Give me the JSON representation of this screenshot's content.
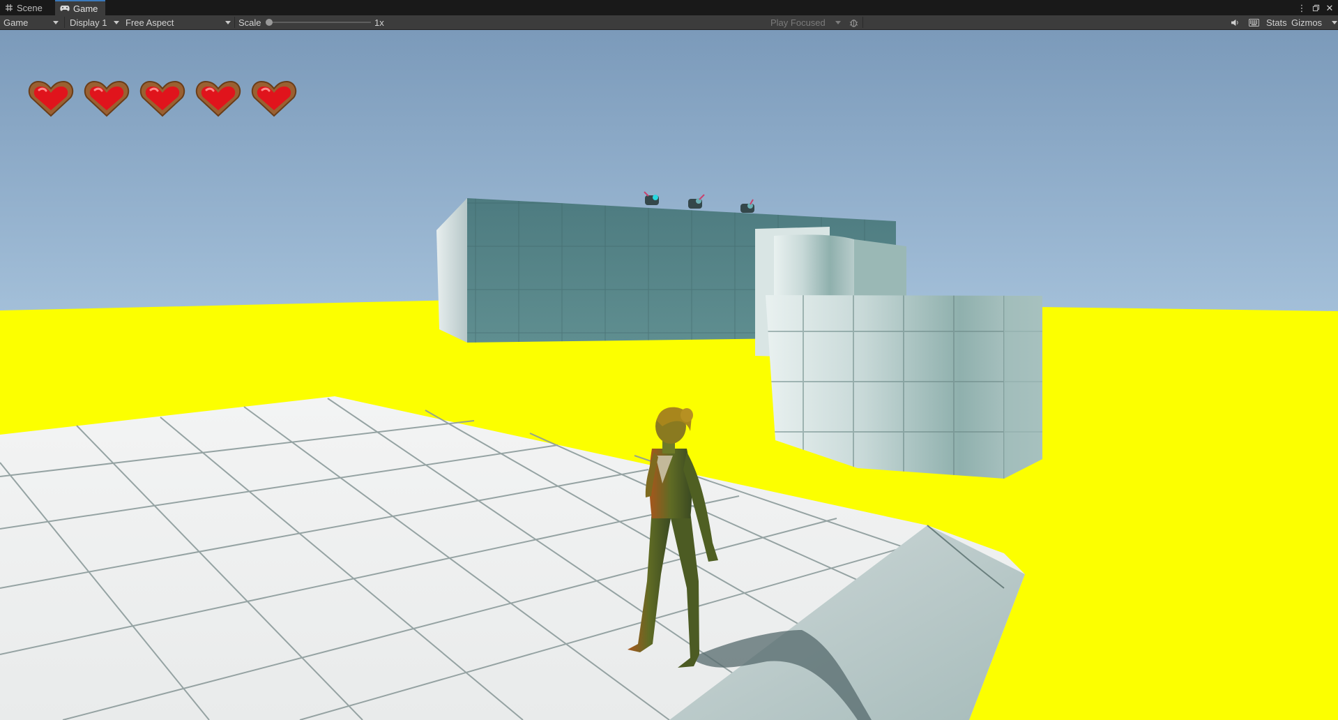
{
  "tabs": [
    {
      "label": "Scene",
      "icon": "grid-icon",
      "active": false
    },
    {
      "label": "Game",
      "icon": "gamepad-icon",
      "active": true
    }
  ],
  "toolbar": {
    "view_mode": "Game",
    "display": "Display 1",
    "aspect": "Free Aspect",
    "scale_label": "Scale",
    "scale_value": "1x",
    "play_mode": "Play Focused",
    "stats_label": "Stats",
    "gizmos_label": "Gizmos",
    "scale_fraction": 0
  },
  "hud": {
    "hearts_total": 5,
    "hearts_full": 5
  },
  "colors": {
    "tab_accent": "#3a79bb",
    "ground": "#fcff00",
    "heart_red": "#e0141c",
    "heart_frame": "#9a6031",
    "sky_top": "#7f9dbb",
    "sky_horizon": "#e4f6f6"
  }
}
